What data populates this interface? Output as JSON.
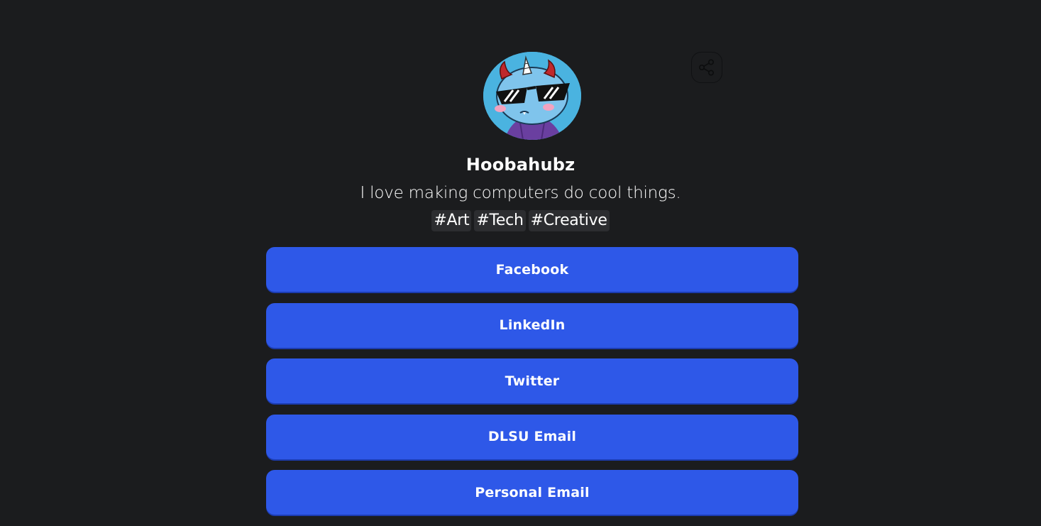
{
  "profile": {
    "name": "Hoobahubz",
    "bio": "I love making computers do cool things.",
    "tags": [
      "#Art",
      "#Tech",
      "#Creative"
    ],
    "avatar_icon": "horned-creature-with-sunglasses-avatar"
  },
  "share": {
    "icon": "share-icon"
  },
  "links": [
    {
      "label": "Facebook"
    },
    {
      "label": "LinkedIn"
    },
    {
      "label": "Twitter"
    },
    {
      "label": "DLSU Email"
    },
    {
      "label": "Personal Email"
    }
  ],
  "colors": {
    "background": "#1b1c1e",
    "button": "#2e58e8",
    "avatar_bg": "#4ab3e0",
    "tag_bg": "#2c2d30"
  }
}
